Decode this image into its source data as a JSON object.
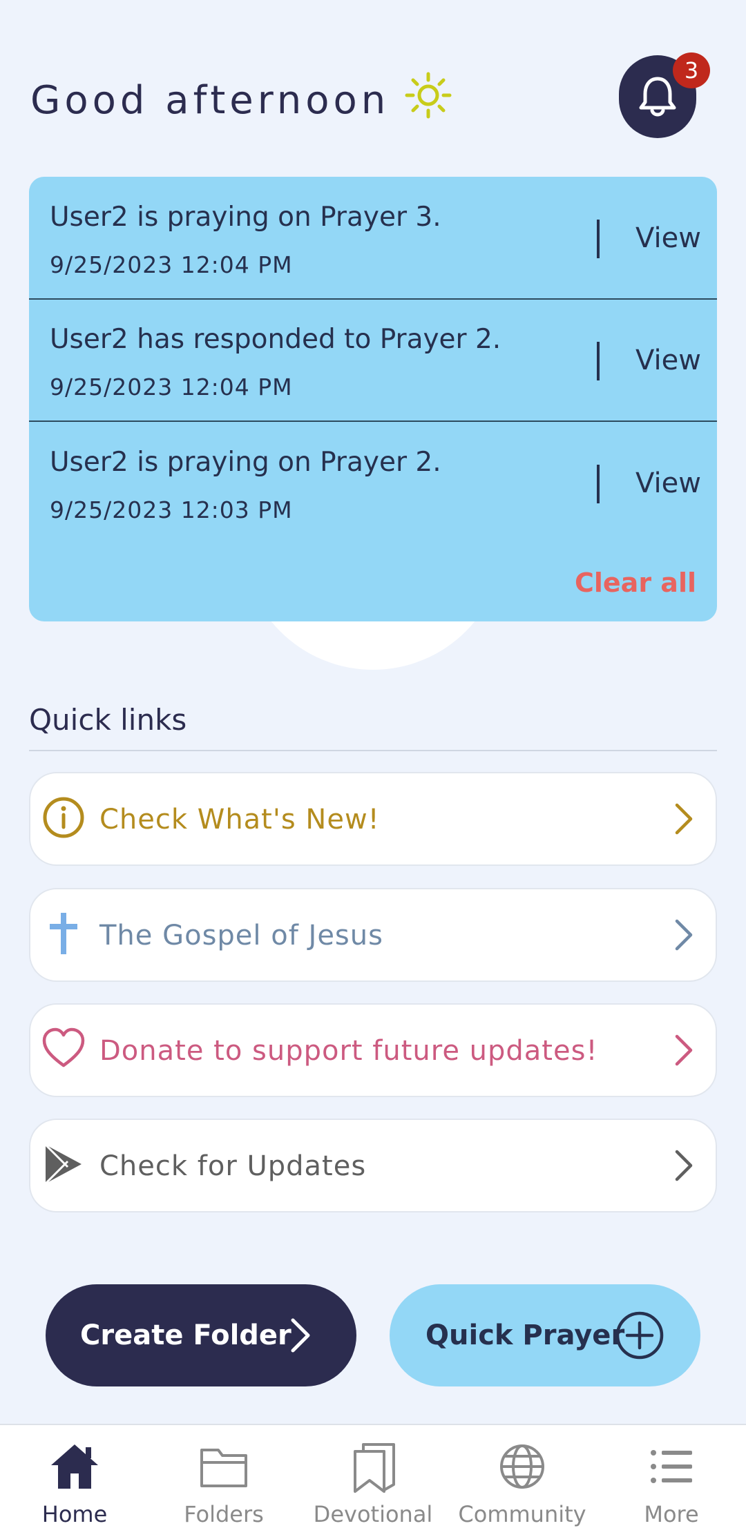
{
  "header": {
    "greeting": "Good afternoon",
    "notification_count": "3"
  },
  "notifications": {
    "items": [
      {
        "title": "User2 is praying on Prayer 3.",
        "time": "9/25/2023 12:04 PM",
        "action": "View"
      },
      {
        "title": "User2 has responded to Prayer 2.",
        "time": "9/25/2023 12:04 PM",
        "action": "View"
      },
      {
        "title": "User2 is praying on Prayer 2.",
        "time": "9/25/2023 12:03 PM",
        "action": "View"
      }
    ],
    "clear_all": "Clear all"
  },
  "quick_links": {
    "title": "Quick links",
    "items": [
      {
        "label": "Check What's New!",
        "icon": "info-icon",
        "color": "#b48c1e"
      },
      {
        "label": "The Gospel of Jesus",
        "icon": "cross-icon",
        "color": "#6f89a6"
      },
      {
        "label": "Donate to support future updates!",
        "icon": "heart-icon",
        "color": "#cc5a80"
      },
      {
        "label": "Check for Updates",
        "icon": "play-store-icon",
        "color": "#5f5f5f"
      }
    ]
  },
  "actions": {
    "create_folder": "Create Folder",
    "quick_prayer": "Quick Prayer"
  },
  "tabs": [
    {
      "label": "Home",
      "icon": "home-icon",
      "active": true
    },
    {
      "label": "Folders",
      "icon": "folder-icon",
      "active": false
    },
    {
      "label": "Devotional",
      "icon": "bookmark-book-icon",
      "active": false
    },
    {
      "label": "Community",
      "icon": "globe-icon",
      "active": false
    },
    {
      "label": "More",
      "icon": "list-icon",
      "active": false
    }
  ],
  "colors": {
    "background": "#eef3fc",
    "navy": "#2c2c4f",
    "sky": "#93d7f6",
    "badge": "#c0281c",
    "clear_all": "#e8645f",
    "sun": "#c8cc1a"
  }
}
